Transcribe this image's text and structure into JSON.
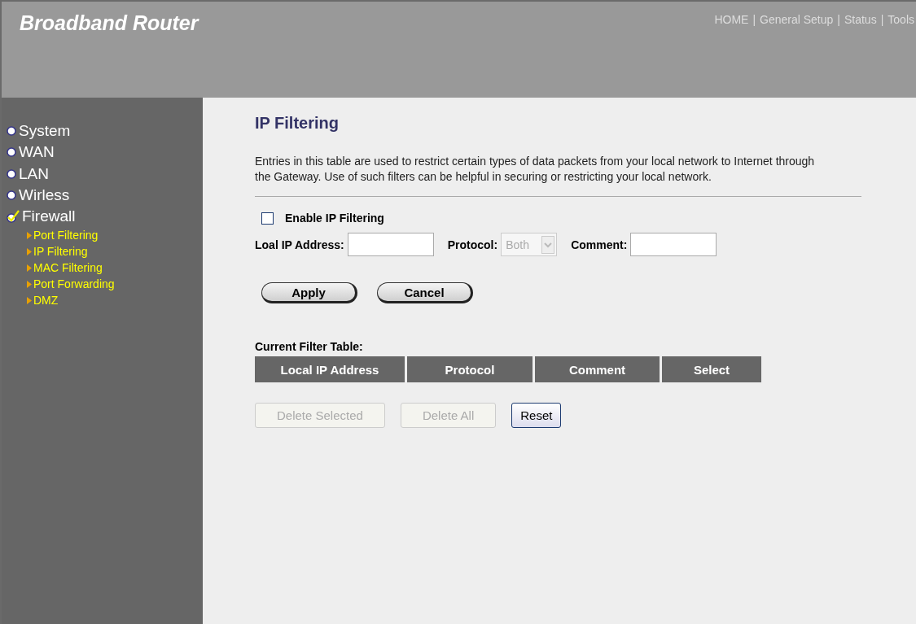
{
  "header": {
    "title": "Broadband Router",
    "nav": [
      "HOME",
      "General Setup",
      "Status",
      "Tools"
    ],
    "separator": "|"
  },
  "sidebar": {
    "items": [
      {
        "label": "System",
        "selected": false
      },
      {
        "label": "WAN",
        "selected": false
      },
      {
        "label": "LAN",
        "selected": false
      },
      {
        "label": "Wirless",
        "selected": false
      },
      {
        "label": "Firewall",
        "selected": true,
        "children": [
          {
            "label": "Port Filtering"
          },
          {
            "label": "IP Filtering"
          },
          {
            "label": "MAC Filtering"
          },
          {
            "label": "Port Forwarding"
          },
          {
            "label": "DMZ"
          }
        ]
      }
    ]
  },
  "content": {
    "title": "IP Filtering",
    "description": "Entries in this table are used to restrict certain types of data packets from your local network to Internet through the Gateway. Use of such filters can be helpful in securing or restricting your local network.",
    "enable": {
      "label": "Enable IP Filtering",
      "checked": false
    },
    "fields": [
      {
        "kind": "text",
        "label": "Loal IP Address:"
      },
      {
        "kind": "select",
        "label": "Protocol:",
        "value": "Both",
        "disabled": true
      },
      {
        "kind": "text",
        "label": "Comment:"
      }
    ],
    "form_buttons": [
      "Apply",
      "Cancel"
    ],
    "table": {
      "title": "Current Filter Table:",
      "columns": [
        "Local IP Address",
        "Protocol",
        "Comment",
        "Select"
      ]
    },
    "table_buttons": [
      {
        "label": "Delete Selected",
        "disabled": true
      },
      {
        "label": "Delete All",
        "disabled": true
      },
      {
        "label": "Reset",
        "disabled": false
      }
    ]
  }
}
